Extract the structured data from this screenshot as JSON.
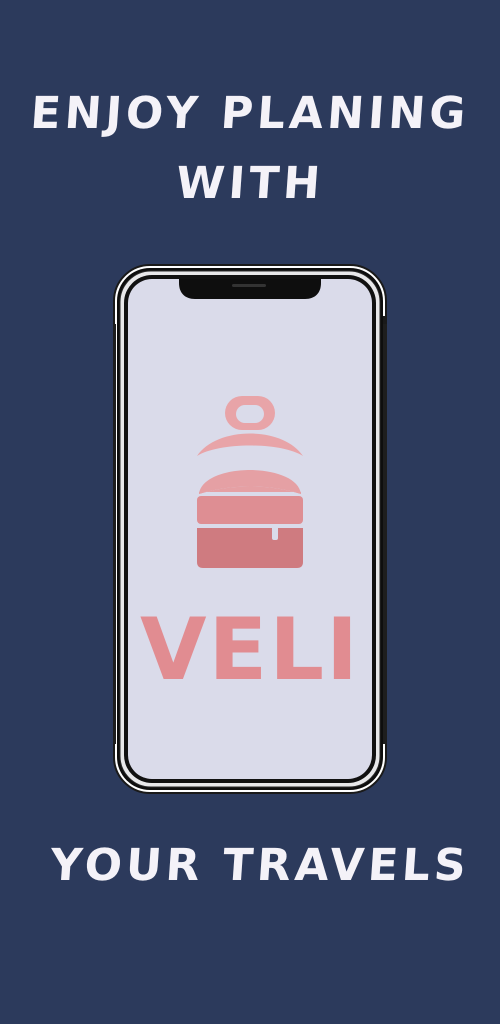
{
  "headline": {
    "line1": "ENJOY PLANING",
    "line2": "WITH",
    "line3": "YOUR TRAVELS"
  },
  "brand": {
    "name": "VELI",
    "icon": "backpack-icon"
  },
  "colors": {
    "background": "#2c3a5c",
    "screen": "#dadbea",
    "brand_pink": "#e18c91",
    "text": "#f4f2f8"
  }
}
